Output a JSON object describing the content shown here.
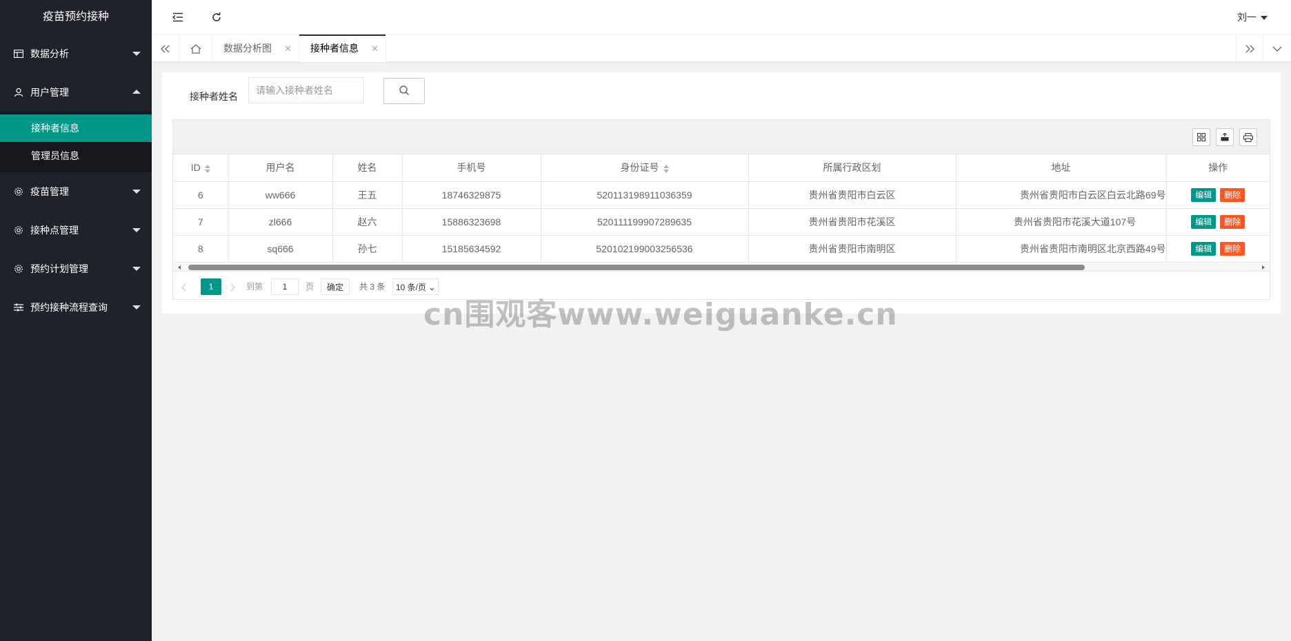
{
  "app_title": "疫苗预约接种",
  "sidebar": {
    "items": [
      {
        "label": "数据分析",
        "icon": "table-icon"
      },
      {
        "label": "用户管理",
        "icon": "user-icon"
      },
      {
        "label": "疫苗管理",
        "icon": "gear-icon"
      },
      {
        "label": "接种点管理",
        "icon": "gear-icon"
      },
      {
        "label": "预约计划管理",
        "icon": "gear-icon"
      },
      {
        "label": "预约接种流程查询",
        "icon": "sliders-icon"
      }
    ],
    "sub_items": [
      {
        "label": "接种者信息",
        "active": true
      },
      {
        "label": "管理员信息",
        "active": false
      }
    ]
  },
  "header": {
    "user": "刘一"
  },
  "tabs": [
    {
      "label": "数据分析图",
      "active": false
    },
    {
      "label": "接种者信息",
      "active": true
    }
  ],
  "search": {
    "label": "接种者姓名",
    "placeholder": "请输入接种者姓名",
    "value": ""
  },
  "table": {
    "columns": [
      "ID",
      "用户名",
      "姓名",
      "手机号",
      "身份证号",
      "所属行政区划",
      "地址",
      "操作"
    ],
    "rows": [
      {
        "id": "6",
        "username": "ww666",
        "name": "王五",
        "phone": "18746329875",
        "idcard": "520113198911036359",
        "region": "贵州省贵阳市白云区",
        "address": "贵州省贵阳市白云区白云北路69号"
      },
      {
        "id": "7",
        "username": "zl666",
        "name": "赵六",
        "phone": "15886323698",
        "idcard": "520111199907289635",
        "region": "贵州省贵阳市花溪区",
        "address": "贵州省贵阳市花溪大道107号"
      },
      {
        "id": "8",
        "username": "sq666",
        "name": "孙七",
        "phone": "15185634592",
        "idcard": "520102199003256536",
        "region": "贵州省贵阳市南明区",
        "address": "贵州省贵阳市南明区北京西路49号"
      }
    ],
    "edit_label": "编辑",
    "delete_label": "删除"
  },
  "pager": {
    "current": "1",
    "goto_label": "到第",
    "goto_value": "1",
    "page_unit": "页",
    "confirm_label": "确定",
    "total_label": "共 3 条",
    "page_size": "10 条/页"
  },
  "watermark": "cn围观客www.weiguanke.cn",
  "colors": {
    "sidebar": "#20222a",
    "accent": "#009688",
    "danger": "#ff5722"
  }
}
